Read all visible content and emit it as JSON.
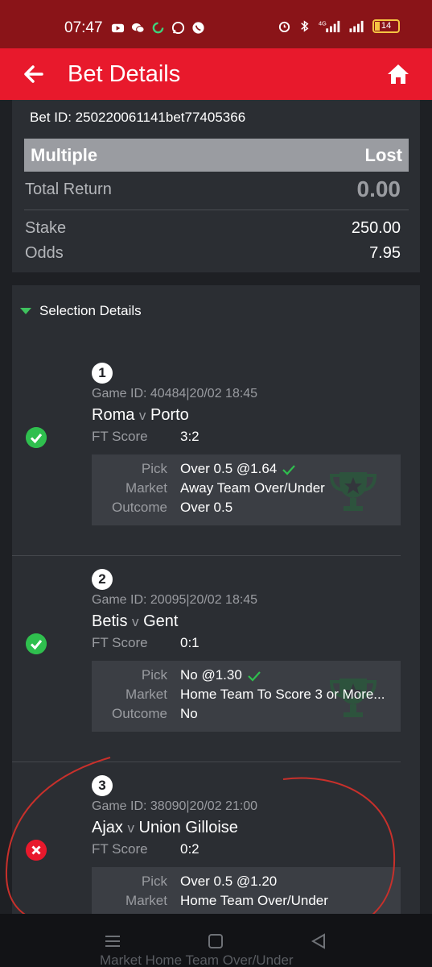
{
  "status_bar": {
    "time": "07:47",
    "network": "4G",
    "battery": "14",
    "icons_left": [
      "youtube-icon",
      "wechat-icon",
      "sync-icon",
      "whatsapp-icon",
      "viber-icon"
    ],
    "icons_right": [
      "alarm-icon",
      "bluetooth-icon",
      "signal-icon",
      "signal-icon",
      "battery-icon"
    ]
  },
  "header": {
    "title": "Bet Details",
    "accent": "#e8192c"
  },
  "summary": {
    "bet_id": "Bet ID: 250220061141bet77405366",
    "type": "Multiple",
    "result": "Lost",
    "total_return_label": "Total Return",
    "total_return": "0.00",
    "stake_label": "Stake",
    "stake": "250.00",
    "odds_label": "Odds",
    "odds": "7.95"
  },
  "selection_details": {
    "title": "Selection Details",
    "labels": {
      "ft_score": "FT Score",
      "pick": "Pick",
      "market": "Market",
      "outcome": "Outcome"
    },
    "items": [
      {
        "number": "1",
        "game_id": "Game ID: 40484|20/02 18:45",
        "home": "Roma",
        "vs": "v",
        "away": "Porto",
        "ft_score": "3:2",
        "pick": "Over 0.5 @1.64",
        "market": "Away Team Over/Under",
        "outcome": "Over 0.5",
        "status": "won"
      },
      {
        "number": "2",
        "game_id": "Game ID: 20095|20/02 18:45",
        "home": "Betis",
        "vs": "v",
        "away": "Gent",
        "ft_score": "0:1",
        "pick": "No @1.30",
        "market": "Home Team To Score 3 or More...",
        "outcome": "No",
        "status": "won"
      },
      {
        "number": "3",
        "game_id": "Game ID: 38090|20/02 21:00",
        "home": "Ajax",
        "vs": "v",
        "away": "Union Gilloise",
        "ft_score": "0:2",
        "pick": "Over 0.5 @1.20",
        "market": "Home Team Over/Under",
        "status": "lost"
      }
    ]
  },
  "nav_overlap_text": "Market    Home Team Over/Under",
  "colors": {
    "won": "#2fbf4e",
    "lost": "#e8192c",
    "annotation": "#c8302b"
  }
}
